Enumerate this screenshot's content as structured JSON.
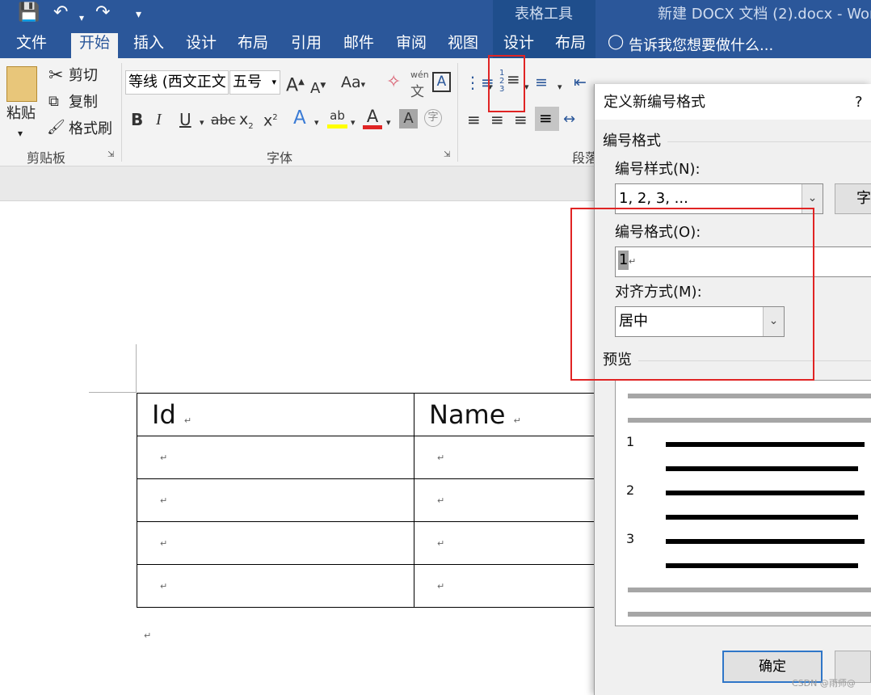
{
  "window": {
    "title": "新建 DOCX 文档 (2).docx - Wor",
    "context_tools": "表格工具"
  },
  "tabs": [
    "文件",
    "开始",
    "插入",
    "设计",
    "布局",
    "引用",
    "邮件",
    "审阅",
    "视图",
    "设计",
    "布局"
  ],
  "tell_me": "告诉我您想要做什么...",
  "clipboard": {
    "paste": "粘贴",
    "cut": "剪切",
    "copy": "复制",
    "format_painter": "格式刷",
    "group": "剪贴板"
  },
  "font": {
    "name": "等线 (西文正文",
    "size": "五号",
    "case": "Aa",
    "pinyin": "wén",
    "group": "字体"
  },
  "paragraph": {
    "group": "段落"
  },
  "table": {
    "headers": [
      "Id",
      "Name"
    ],
    "empty_rows": 4
  },
  "dialog": {
    "title": "定义新编号格式",
    "help": "?",
    "section_format": "编号格式",
    "style_label": "编号样式(N):",
    "style_value": "1, 2, 3, ...",
    "font_button": "字",
    "format_label": "编号格式(O):",
    "format_value": "1",
    "align_label": "对齐方式(M):",
    "align_value": "居中",
    "preview_label": "预览",
    "preview_numbers": [
      "1",
      "2",
      "3"
    ],
    "ok": "确定"
  },
  "watermark": "CSDN @雨师@",
  "colors": {
    "ribbon_blue": "#2b579a",
    "highlight_red": "#e02424"
  }
}
